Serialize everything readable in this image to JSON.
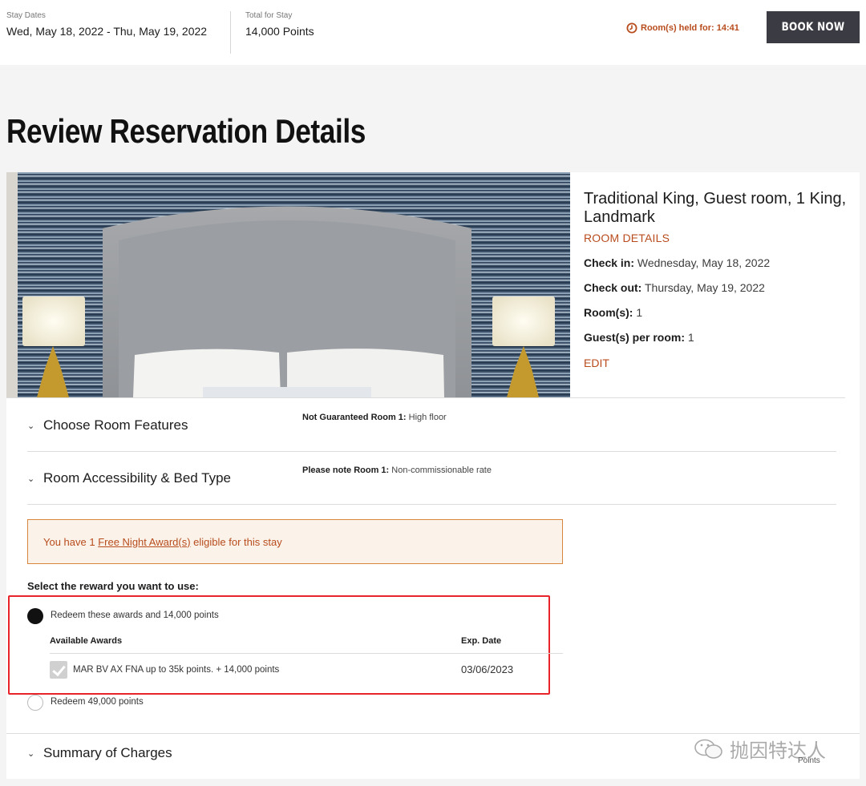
{
  "topbar": {
    "stay_dates_label": "Stay Dates",
    "stay_dates_value": "Wed, May 18, 2022 - Thu, May 19, 2022",
    "total_label": "Total for Stay",
    "total_value": "14,000 Points",
    "held_text": "Room(s) held for: 14:41",
    "book_now_label": "BOOK NOW"
  },
  "page_title": "Review Reservation Details",
  "room": {
    "name": "Traditional King, Guest room, 1 King, Landmark",
    "details_link": "ROOM DETAILS",
    "check_in_label": "Check in:",
    "check_in_value": "Wednesday, May 18, 2022",
    "check_out_label": "Check out:",
    "check_out_value": "Thursday, May 19, 2022",
    "rooms_label": "Room(s):",
    "rooms_value": "1",
    "guests_label": "Guest(s) per room:",
    "guests_value": "1",
    "edit_link": "EDIT"
  },
  "sections": {
    "room_features": "Choose Room Features",
    "room_features_note_label": "Not Guaranteed Room 1:",
    "room_features_note_value": "High floor",
    "accessibility": "Room Accessibility & Bed Type",
    "accessibility_note_label": "Please note Room 1:",
    "accessibility_note_value": "Non-commissionable rate",
    "summary": "Summary of Charges",
    "summary_points_label": "Points"
  },
  "award_banner": {
    "prefix": "You have 1 ",
    "link": "Free Night Award(s)",
    "suffix": " eligible for this stay"
  },
  "rewards": {
    "select_label": "Select the reward you want to use:",
    "option_awards": "Redeem these awards and 14,000 points",
    "col_available": "Available Awards",
    "col_exp": "Exp. Date",
    "award_name": "MAR BV AX FNA up to 35k points. + 14,000 points",
    "award_exp": "03/06/2023",
    "option_points": "Redeem 49,000 points"
  },
  "watermark": "抛因特达人",
  "colors": {
    "accent": "#b84c1d",
    "button": "#3b3b43",
    "highlight": "#e8232a",
    "banner_bg": "#fbf3ea"
  }
}
